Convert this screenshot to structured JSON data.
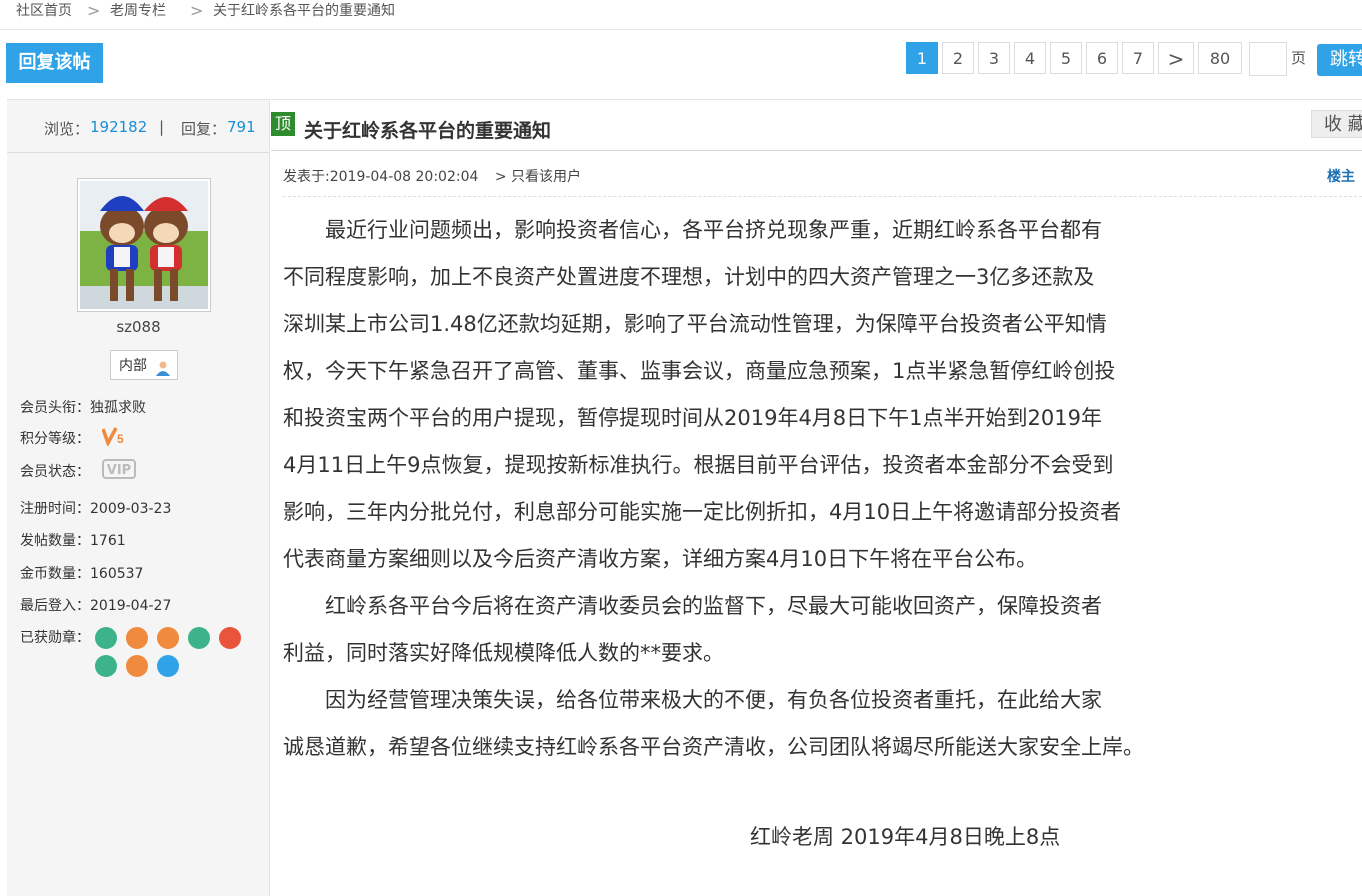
{
  "breadcrumb": {
    "home": "社区首页",
    "column": "老周专栏",
    "current": "关于红岭系各平台的重要通知",
    "separator": ">"
  },
  "toolbar": {
    "reply_label": "回复该帖"
  },
  "pager": {
    "pages": [
      "1",
      "2",
      "3",
      "4",
      "5",
      "6",
      "7",
      ">",
      "80"
    ],
    "active": "1",
    "unit": "页",
    "jump_label": "跳转"
  },
  "stats": {
    "views_label": "浏览：",
    "views": "192182",
    "divider": "|",
    "replies_label": "回复：",
    "replies": "791"
  },
  "user": {
    "name": "sz088",
    "group_badge": "内部",
    "rows": [
      {
        "label": "会员头衔：",
        "value": "独孤求败"
      },
      {
        "label": "积分等级：",
        "value": "V5"
      },
      {
        "label": "会员状态：",
        "value": "VIP"
      },
      {
        "label": "注册时间：",
        "value": "2009-03-23"
      },
      {
        "label": "发帖数量：",
        "value": "1761"
      },
      {
        "label": "金币数量：",
        "value": "160537"
      },
      {
        "label": "最后登入：",
        "value": "2019-04-27"
      },
      {
        "label": "已获勋章：",
        "value": ""
      }
    ],
    "medal_colors": [
      "#3cb38b",
      "#f08a3c",
      "#f08a3c",
      "#3cb38b",
      "#e8553a",
      "#3cb38b",
      "#f08a3c",
      "#2fa2e8"
    ]
  },
  "post": {
    "top_tag": "顶",
    "title": "关于红岭系各平台的重要通知",
    "favorite_label": "收 藏",
    "meta_time": "发表于:2019-04-08 20:02:04",
    "meta_only": "> 只看该用户",
    "floor": "楼主",
    "lines": [
      "　　最近行业问题频出，影响投资者信心，各平台挤兑现象严重，近期红岭系各平台都有",
      "不同程度影响，加上不良资产处置进度不理想，计划中的四大资产管理之一3亿多还款及",
      "深圳某上市公司1.48亿还款均延期，影响了平台流动性管理，为保障平台投资者公平知情",
      "权，今天下午紧急召开了高管、董事、监事会议，商量应急预案，1点半紧急暂停红岭创投",
      "和投资宝两个平台的用户提现，暂停提现时间从2019年4月8日下午1点半开始到2019年",
      "4月11日上午9点恢复，提现按新标准执行。根据目前平台评估，投资者本金部分不会受到",
      "影响，三年内分批兑付，利息部分可能实施一定比例折扣，4月10日上午将邀请部分投资者",
      "代表商量方案细则以及今后资产清收方案，详细方案4月10日下午将在平台公布。",
      "　　红岭系各平台今后将在资产清收委员会的监督下，尽最大可能收回资产，保障投资者",
      "利益，同时落实好降低规模降低人数的**要求。",
      "　　因为经营管理决策失误，给各位带来极大的不便，有负各位投资者重托，在此给大家",
      "诚恳道歉，希望各位继续支持红岭系各平台资产清收，公司团队将竭尽所能送大家安全上岸。"
    ],
    "signature": "红岭老周  2019年4月8日晚上8点"
  }
}
